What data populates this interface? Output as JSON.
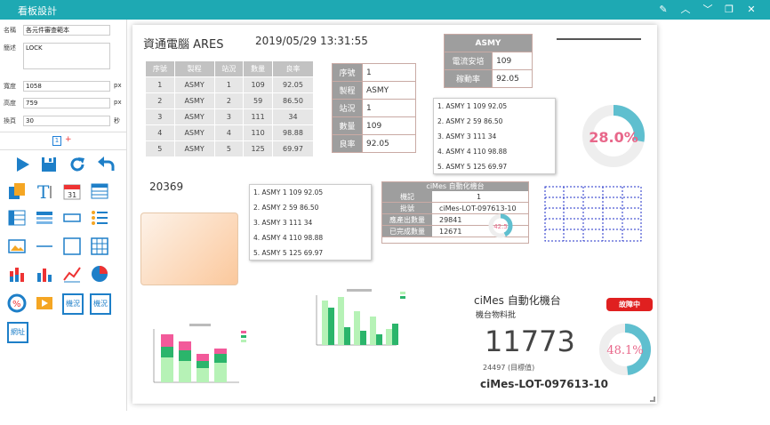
{
  "window": {
    "title": "看板設計"
  },
  "form": {
    "name_label": "名稱",
    "name_value": "各元件審查範本",
    "desc_label": "簡述",
    "desc_value": "LOCK",
    "width_label": "寬度",
    "width_value": "1058",
    "width_unit": "px",
    "height_label": "高度",
    "height_value": "759",
    "height_unit": "px",
    "refresh_label": "換頁",
    "refresh_value": "30",
    "refresh_unit": "秒",
    "page_num": "1",
    "page_add": "+"
  },
  "widgets": {
    "status_box_1": "機況",
    "status_box_2": "機況",
    "link_box": "網址"
  },
  "canvas": {
    "header_title": "資通電腦 ARES",
    "datetime": "2019/05/29 13:31:55",
    "counter": "20369",
    "table1": {
      "headers": [
        "序號",
        "製程",
        "站況",
        "數量",
        "良率"
      ],
      "rows": [
        [
          "1",
          "ASMY",
          "1",
          "109",
          "92.05"
        ],
        [
          "2",
          "ASMY",
          "2",
          "59",
          "86.50"
        ],
        [
          "3",
          "ASMY",
          "3",
          "111",
          "34"
        ],
        [
          "4",
          "ASMY",
          "4",
          "110",
          "98.88"
        ],
        [
          "5",
          "ASMY",
          "5",
          "125",
          "69.97"
        ]
      ]
    },
    "kv": {
      "labels": [
        "序號",
        "製程",
        "站況",
        "數量",
        "良率"
      ],
      "values": [
        "1",
        "ASMY",
        "1",
        "109",
        "92.05"
      ]
    },
    "asmy": {
      "header": "ASMY",
      "row1_label": "電流安培",
      "row1_value": "109",
      "row2_label": "稼動率",
      "row2_value": "92.05"
    },
    "list_items": [
      "1. ASMY 1 109 92.05",
      "2. ASMY 2 59 86.50",
      "3. ASMY 3 111 34",
      "4. ASMY 4 110 98.88",
      "5. ASMY 5 125 69.97"
    ],
    "gauge_top": {
      "value": "28.0%",
      "fraction": 0.28
    },
    "cimes_small": {
      "title": "ciMes 自動化機台",
      "labels": [
        "機記",
        "批號",
        "應產出數量",
        "已完成數量"
      ],
      "values": [
        "1",
        "ciMes-LOT-097613-10",
        "29841",
        "12671"
      ],
      "gauge": "42.5",
      "fraction": 0.425
    },
    "cimes_big": {
      "title": "ciMes 自動化機台",
      "subtitle": "機台物料批",
      "status": "故障中",
      "big_number": "11773",
      "sub_number": "24497 (目標值)",
      "lot": "ciMes-LOT-097613-10",
      "gauge": "48.1%",
      "fraction": 0.481
    },
    "colors": {
      "accent": "#1ea9b3",
      "gauge": "#5fbfcf",
      "gauge_text": "#e8678a",
      "status_red": "#e02020"
    }
  }
}
